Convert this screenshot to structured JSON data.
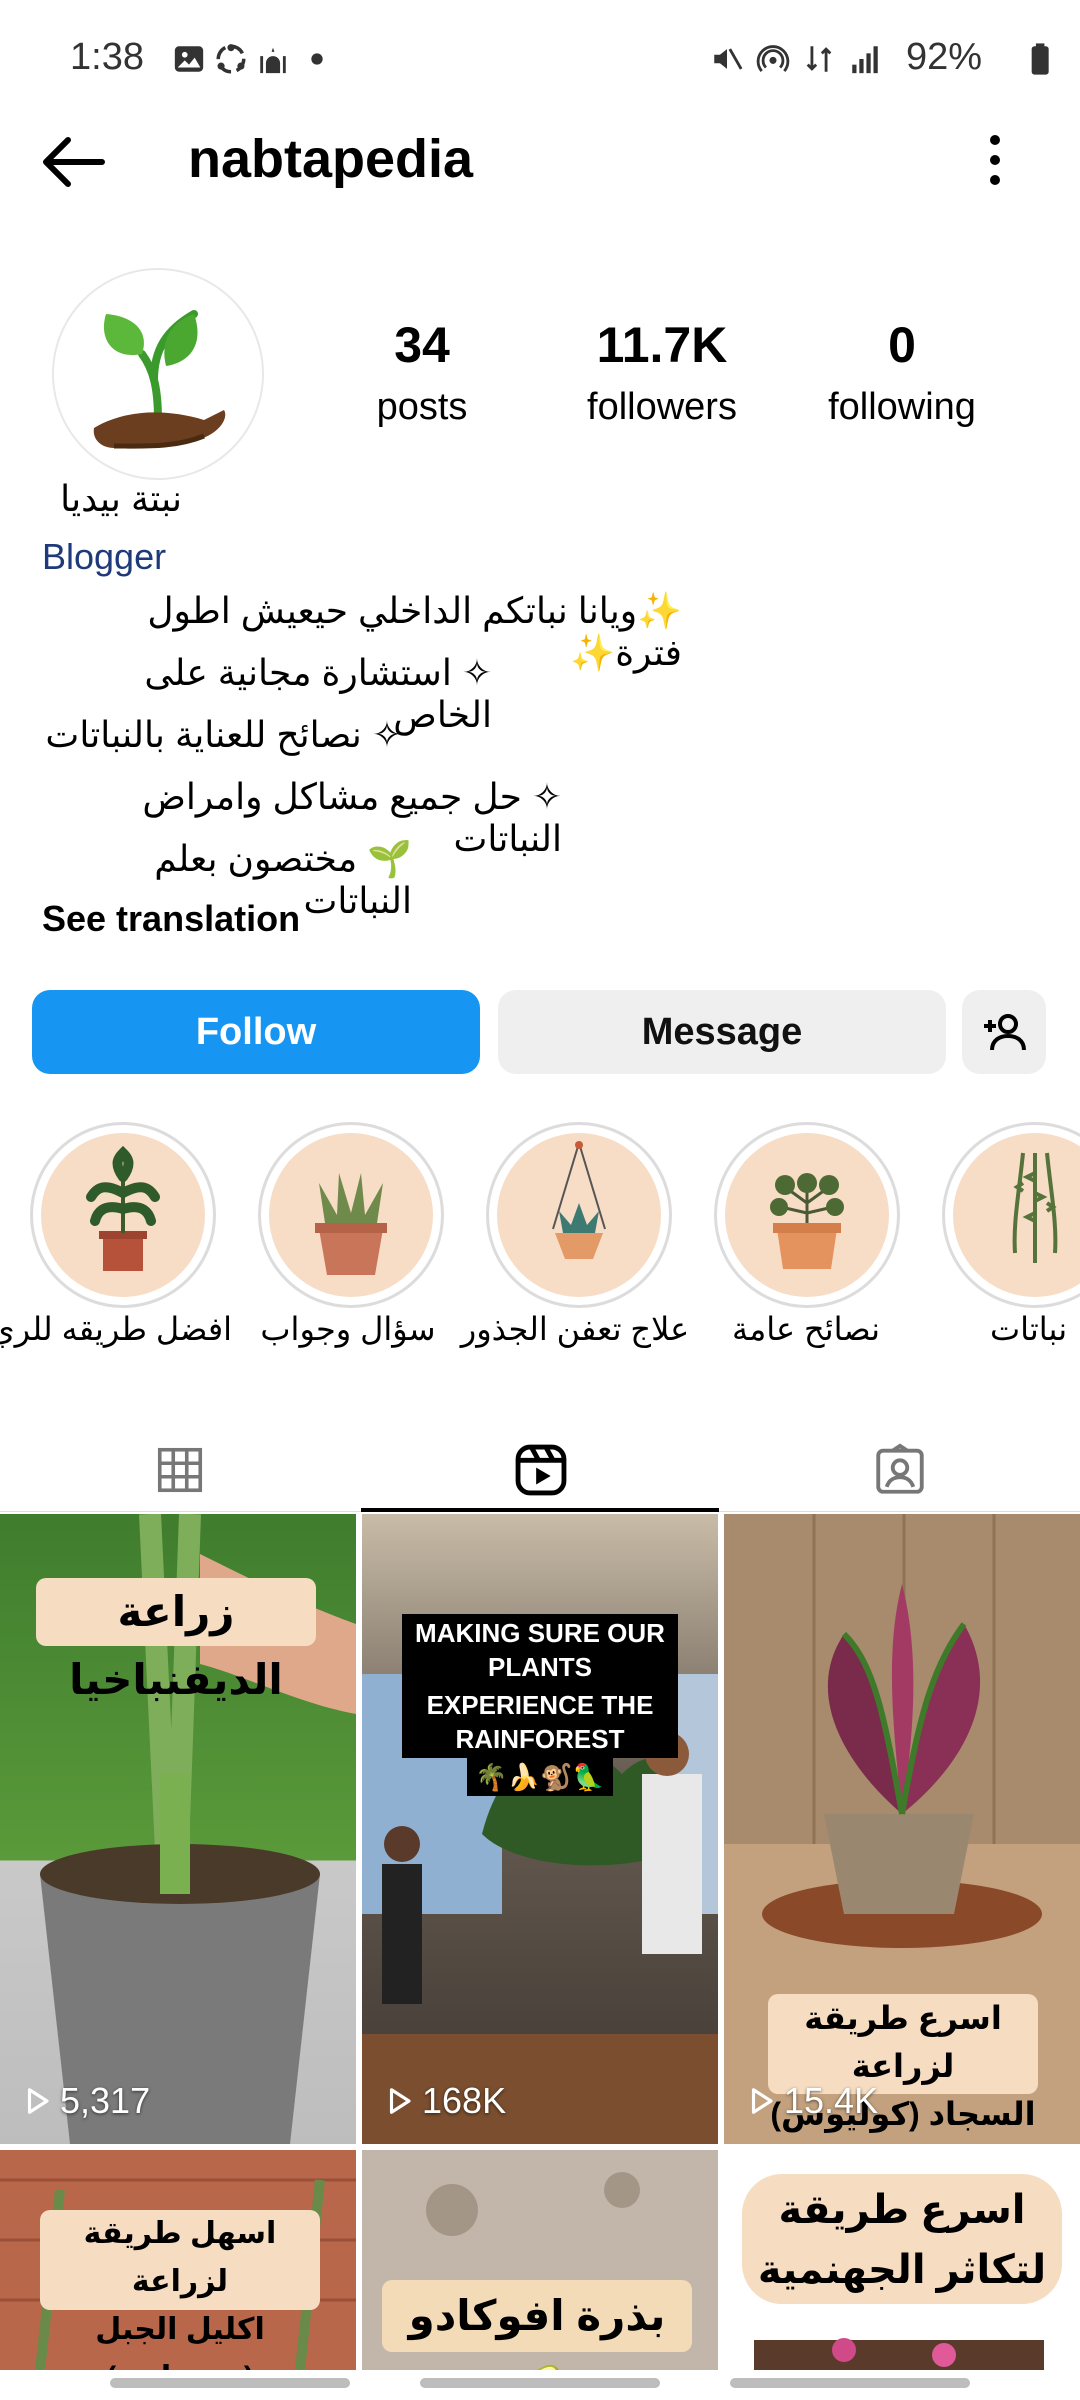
{
  "status_bar": {
    "time": "1:38",
    "battery": "92%",
    "icons": [
      "gallery-icon",
      "sync-icon",
      "mosque-icon",
      "dot-icon",
      "mute-icon",
      "hotspot-icon",
      "data-icon",
      "signal-icon",
      "battery-icon"
    ]
  },
  "header": {
    "username": "nabtapedia",
    "back_icon": "back-arrow-icon",
    "menu_icon": "kebab-menu-icon"
  },
  "profile": {
    "stats": [
      {
        "value": "34",
        "label": "posts"
      },
      {
        "value": "11.7K",
        "label": "followers"
      },
      {
        "value": "0",
        "label": "following"
      }
    ],
    "name": "نبتة بيديا",
    "category": "Blogger",
    "bio_lines": [
      "✨ويانا نباتكم الداخلي حيعيش اطول فترة✨",
      "✧ استشارة مجانية على الخاص",
      "✧ نصائح للعناية بالنباتات",
      "✧ حل جميع مشاكل وامراض النباتات",
      "🌱 مختصون بعلم النباتات"
    ],
    "see_translation": "See translation"
  },
  "actions": {
    "follow": "Follow",
    "message": "Message",
    "add_user_icon": "add-user-icon"
  },
  "highlights": [
    {
      "label": "افضل طريقه للري"
    },
    {
      "label": "سؤال وجواب"
    },
    {
      "label": "علاج تعفن الجذور"
    },
    {
      "label": "نصائح عامة"
    },
    {
      "label": "نباتات"
    }
  ],
  "tabs": [
    {
      "name": "grid-icon",
      "active": false
    },
    {
      "name": "reels-icon",
      "active": true
    },
    {
      "name": "tagged-icon",
      "active": false
    }
  ],
  "grid": [
    {
      "caption": "زراعة الديفنباخيا",
      "views": "5,317"
    },
    {
      "caption_line1": "MAKING SURE OUR PLANTS",
      "caption_line2": "EXPERIENCE THE RAINFOREST",
      "emoji": "🌴🍌🐒🦜",
      "views": "168K"
    },
    {
      "caption_line1": "اسرع طريقة لزراعة",
      "caption_line2": "السجاد (كوليوس)",
      "views": "15.4K"
    },
    {
      "caption_line1": "اسهل طريقة لزراعة",
      "caption_line2": "اكليل الجبل (روزماري)"
    },
    {
      "caption": "بذرة افوكادو",
      "emoji": "🥑"
    },
    {
      "caption_line1": "اسرع طريقة",
      "caption_line2": "لتكاثر الجهنمية"
    }
  ]
}
